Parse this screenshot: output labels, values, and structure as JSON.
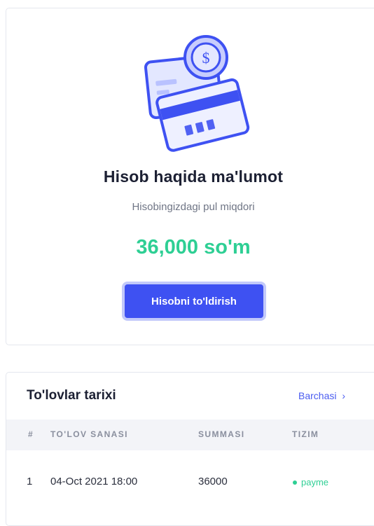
{
  "balance": {
    "title": "Hisob haqida ma'lumot",
    "subtitle": "Hisobingizdagi pul miqdori",
    "amount": "36,000 so'm",
    "topup_label": "Hisobni to'ldirish",
    "illustration_icon": "wallet-cards-icon",
    "coin_symbol": "$",
    "accent_color": "#3e51f2",
    "amount_color": "#2ecf94"
  },
  "history": {
    "title": "To'lovlar tarixi",
    "view_all_label": "Barchasi",
    "view_all_icon": "chevron-right-icon",
    "view_all_chevron": "›",
    "columns": [
      "#",
      "TO'LOV SANASI",
      "SUMMASI",
      "TIZIM"
    ],
    "rows": [
      {
        "index": "1",
        "date": "04-Oct 2021 18:00",
        "amount": "36000",
        "system": "payme",
        "status_color": "#2ecf94"
      }
    ]
  }
}
